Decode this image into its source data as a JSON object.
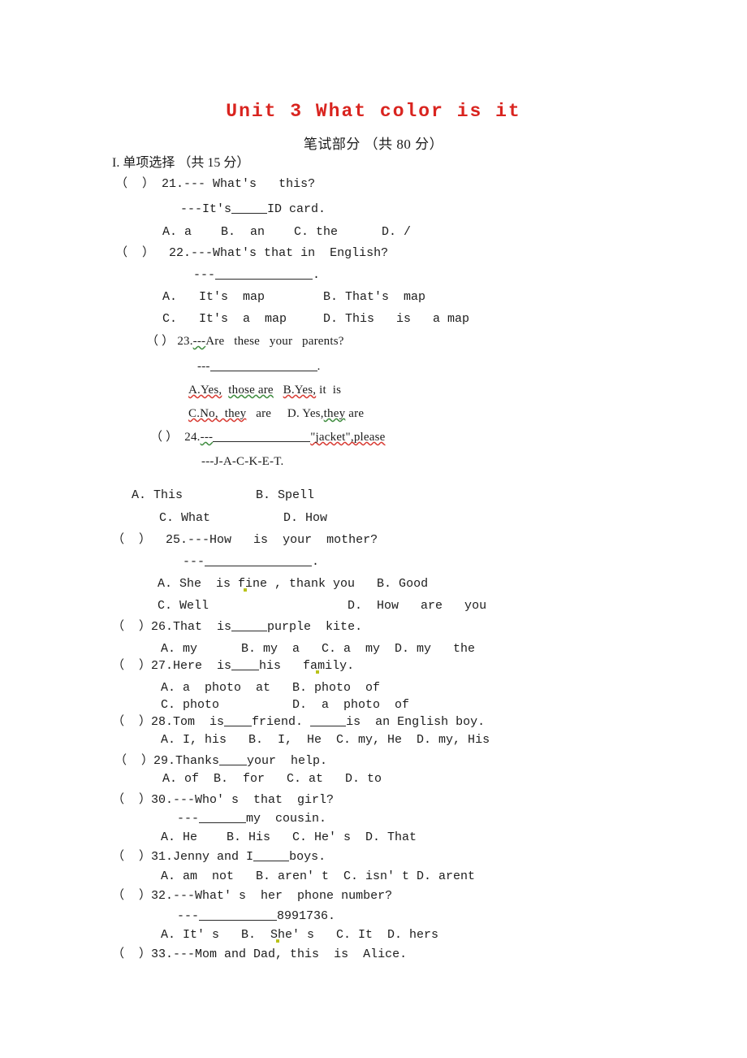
{
  "document": {
    "title": "Unit 3 What color is it",
    "title_color": "#d9241f",
    "subtitle": "笔试部分 （共 80 分）",
    "section_heading": "I. 单项选择 （共 15 分）"
  },
  "questions": [
    {
      "id": "q21",
      "marker": "（  ）",
      "number": "21.",
      "stem": "--- What's   this?",
      "stem2_pre": "---It's",
      "stem2_post": "ID card.",
      "options": "A. a    B.  an    C. the      D. /"
    },
    {
      "id": "q22",
      "marker": "（  ）",
      "number": "22.",
      "stem": "---What's that in  English?",
      "stem2_pre": "---",
      "stem2_post": ".",
      "options_a": "A.   It's  map        B. That's  map",
      "options_b": "C.   It's  a  map     D. This   is   a map"
    },
    {
      "id": "q23",
      "marker": "（ ）",
      "number": "23.",
      "dashes": "---",
      "stem": "Are   these   your   parents?",
      "stem2_pre": "---",
      "stem2_post": ".",
      "opt_a": "A.Yes,",
      "opt_a2": "those are",
      "opt_b": "B.Yes,",
      "opt_b2": "it  is",
      "opt_c": "C.No,  they",
      "opt_c2": "are",
      "opt_d_lead": "D. Yes,",
      "opt_d": "they",
      "opt_d2": "are"
    },
    {
      "id": "q24",
      "marker": "（ ）",
      "number": "24.",
      "dashes": "---",
      "stem_tail": "\"jacket\",please",
      "stem2": "---J-A-C-K-E-T.",
      "options_a": "A. This          B. Spell",
      "options_b": "C. What          D. How"
    },
    {
      "id": "q25",
      "marker": "（  ）",
      "number": "25.",
      "stem": "---How   is  your  mother?",
      "stem2_pre": "---",
      "stem2_post": ".",
      "options_a": "A. She  is f",
      "options_a2": "ine , thank you   B. Good",
      "options_b": "C. Well                   D.  How   are   you"
    },
    {
      "id": "q26",
      "marker": "（  ）",
      "number": "26.",
      "stem_pre": "That  is",
      "stem_post": "purple  kite.",
      "options": "A. my      B. my  a   C. a  my  D. my   the"
    },
    {
      "id": "q27",
      "marker": "（  ）",
      "number": "27.",
      "stem_pre": "Here  is",
      "stem_post_a": "his   fa",
      "stem_post_b": "mily.",
      "options_a": "A. a  photo  at   B. photo  of",
      "options_b": "C. photo          D.  a  photo  of"
    },
    {
      "id": "q28",
      "marker": "（  ）",
      "number": "28.",
      "stem_pre": "Tom  is",
      "stem_mid": "friend.",
      "stem_post": "is  an English boy.",
      "options": "A. I, his   B.  I,  He  C. my, He  D. my, His"
    },
    {
      "id": "q29",
      "marker": "（  ）",
      "number": "29.",
      "stem_pre": "Thanks",
      "stem_post": "your  help.",
      "options": "A. of  B.  for   C. at   D. to"
    },
    {
      "id": "q30",
      "marker": "（  ）",
      "number": "30.",
      "stem": "---Who' s  that  girl?",
      "stem2_pre": "---",
      "stem2_post": "my  cousin.",
      "options": "A. He    B. His   C. He' s  D. That"
    },
    {
      "id": "q31",
      "marker": "（  ）",
      "number": "31.",
      "stem_pre": "Jenny and I",
      "stem_post": "boys.",
      "options": "A. am  not   B. aren' t  C. isn' t D. arent"
    },
    {
      "id": "q32",
      "marker": "（  ）",
      "number": "32.",
      "stem": "---What' s  her  phone number?",
      "stem2_pre": "---",
      "stem2_post": "8991736.",
      "options_pre": "A. It' s   B.  S",
      "options_post": "he' s   C. It  D. hers"
    },
    {
      "id": "q33",
      "marker": "（  ）",
      "number": "33.",
      "stem": "---Mom and Dad, this  is  Alice."
    }
  ],
  "colors": {
    "title_red": "#d9241f",
    "spell_red": "#d83a32",
    "grammar_green": "#3d8b3d",
    "text": "#1c1c1c",
    "background": "#ffffff"
  }
}
